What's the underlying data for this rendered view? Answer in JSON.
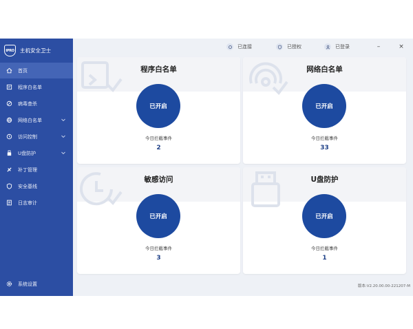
{
  "app": {
    "logo_text": "IPRO",
    "title": "主机安全卫士"
  },
  "sidebar": {
    "items": [
      {
        "label": "首页",
        "icon": "home-icon",
        "active": true
      },
      {
        "label": "程序白名单",
        "icon": "program-icon"
      },
      {
        "label": "病毒查杀",
        "icon": "virus-icon"
      },
      {
        "label": "网络白名单",
        "icon": "network-icon",
        "expandable": true
      },
      {
        "label": "访问控制",
        "icon": "access-icon",
        "expandable": true
      },
      {
        "label": "U盘防护",
        "icon": "usb-icon",
        "expandable": true
      },
      {
        "label": "补丁管理",
        "icon": "patch-icon"
      },
      {
        "label": "安全基线",
        "icon": "shield-icon"
      },
      {
        "label": "日志审计",
        "icon": "log-icon"
      }
    ],
    "settings_label": "系统设置"
  },
  "topbar": {
    "connected": "已连接",
    "authorized": "已授权",
    "logged_in": "已登录",
    "minimize": "–",
    "close": "×"
  },
  "cards": [
    {
      "title": "程序白名单",
      "status": "已开启",
      "stat_label": "今日拦截事件",
      "stat_value": "2"
    },
    {
      "title": "网络白名单",
      "status": "已开启",
      "stat_label": "今日拦截事件",
      "stat_value": "33"
    },
    {
      "title": "敏感访问",
      "status": "已开启",
      "stat_label": "今日拦截事件",
      "stat_value": "3"
    },
    {
      "title": "U盘防护",
      "status": "已开启",
      "stat_label": "今日拦截事件",
      "stat_value": "1"
    }
  ],
  "version": "版本:V2.20.00.00-221207-M",
  "colors": {
    "sidebar": "#2c4ea3",
    "sidebar_active": "#4465b6",
    "accent": "#1d4aa0",
    "background": "#eef1f6"
  }
}
